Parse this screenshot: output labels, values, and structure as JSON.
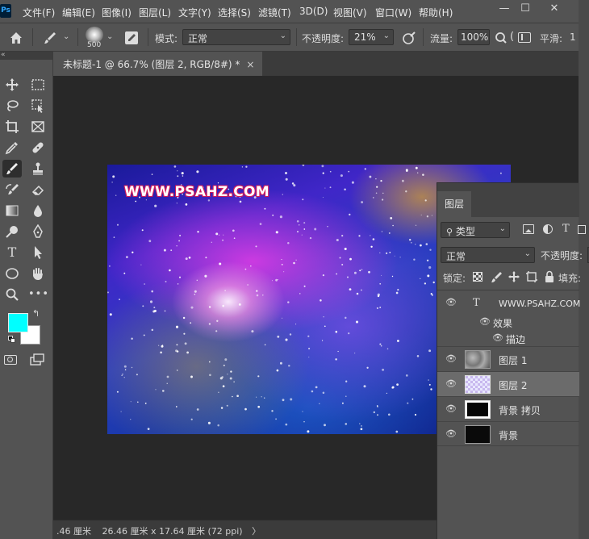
{
  "app": {
    "logo": "Ps"
  },
  "menu": [
    "文件(F)",
    "编辑(E)",
    "图像(I)",
    "图层(L)",
    "文字(Y)",
    "选择(S)",
    "滤镜(T)",
    "3D(D)",
    "视图(V)",
    "窗口(W)",
    "帮助(H)"
  ],
  "window_controls": {
    "minimize": "—",
    "maximize": "☐",
    "close": "✕"
  },
  "options": {
    "brush_size": "500",
    "mode_label": "模式:",
    "mode_value": "正常",
    "opacity_label": "不透明度:",
    "opacity_value": "21%",
    "flow_label": "流量:",
    "flow_value": "100%",
    "smooth_label": "平滑:",
    "smooth_value": "1"
  },
  "document": {
    "tab_title": "未标题-1 @ 66.7% (图层 2, RGB/8#) *",
    "close": "×"
  },
  "artwork": {
    "text": "WWW.PSAHZ.COM"
  },
  "status": {
    "zoom": ".46 厘米",
    "doc_size": "26.46 厘米 x 17.64 厘米 (72 ppi)",
    "arrow": "〉"
  },
  "colors": {
    "foreground": "#00ffff",
    "background": "#ffffff"
  },
  "layers_panel": {
    "tab": "图层",
    "filter_label": "类型",
    "blend_mode": "正常",
    "opacity_label": "不透明度:",
    "lock_label": "锁定:",
    "fill_label": "填充:",
    "text_layer": "WWW.PSAHZ.COM",
    "effects_label": "效果",
    "stroke_label": "描边",
    "layers": [
      {
        "name": "图层 1",
        "selected": false
      },
      {
        "name": "图层 2",
        "selected": true
      },
      {
        "name": "背景 拷贝",
        "selected": false
      },
      {
        "name": "背景",
        "selected": false
      }
    ]
  }
}
